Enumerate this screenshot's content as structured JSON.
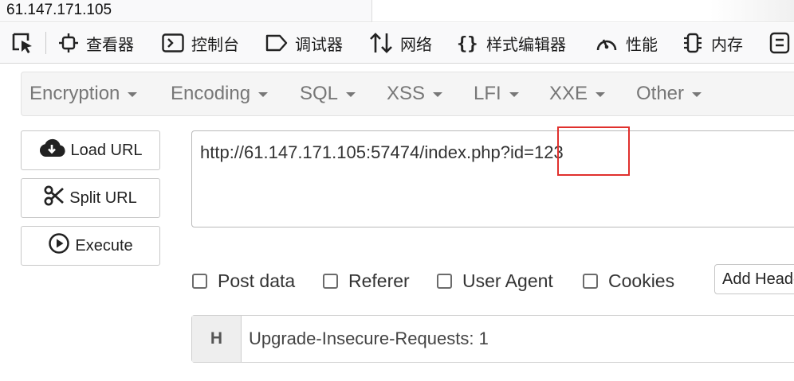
{
  "title_bar": {
    "text": "61.147.171.105"
  },
  "devtools": {
    "picker_icon": "element-picker-icon",
    "tabs": [
      {
        "label": "查看器",
        "icon": "inspector-icon"
      },
      {
        "label": "控制台",
        "icon": "console-icon"
      },
      {
        "label": "调试器",
        "icon": "debugger-icon"
      },
      {
        "label": "网络",
        "icon": "network-icon"
      },
      {
        "label": "样式编辑器",
        "icon": "style-editor-icon"
      },
      {
        "label": "性能",
        "icon": "performance-icon"
      },
      {
        "label": "内存",
        "icon": "memory-icon"
      }
    ],
    "overflow_icon": "storage-icon"
  },
  "hackbar": {
    "menus": [
      "Encryption",
      "Encoding",
      "SQL",
      "XSS",
      "LFI",
      "XXE",
      "Other"
    ],
    "buttons": {
      "load_url": "Load URL",
      "split_url": "Split URL",
      "execute": "Execute"
    },
    "url": "http://61.147.171.105:57474/index.php?id=123",
    "options": {
      "post_data": "Post data",
      "referer": "Referer",
      "user_agent": "User Agent",
      "cookies": "Cookies"
    },
    "add_header_label": "Add Header",
    "header": {
      "badge": "H",
      "value": "Upgrade-Insecure-Requests: 1"
    },
    "highlight_color": "#e0302d"
  }
}
